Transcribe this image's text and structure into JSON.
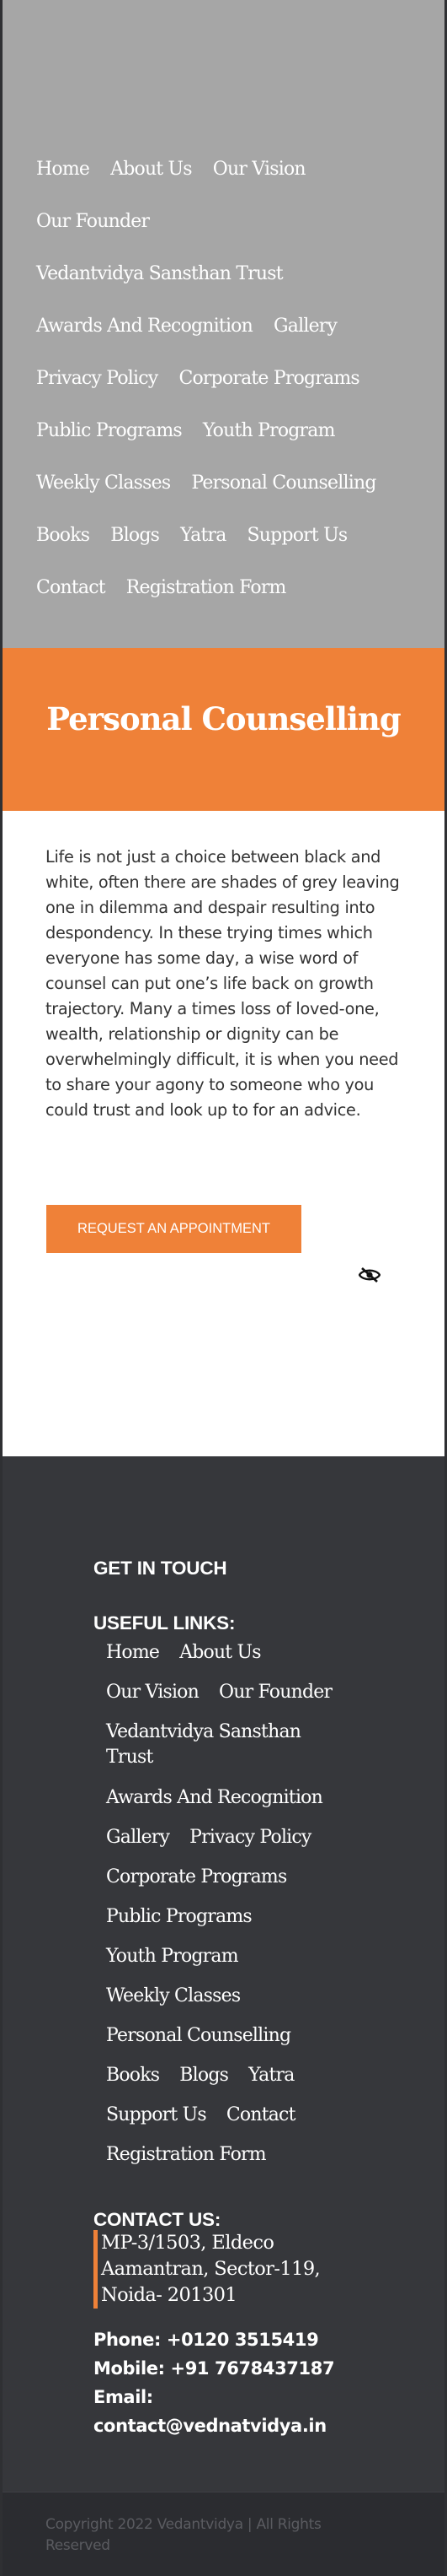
{
  "nav": {
    "rows": [
      [
        "Home",
        "About Us",
        "Our Vision"
      ],
      [
        "Our Founder"
      ],
      [
        "Vedantvidya Sansthan Trust"
      ],
      [
        "Awards And Recognition",
        "Gallery"
      ],
      [
        "Privacy Policy",
        "Corporate Programs"
      ],
      [
        "Public Programs",
        "Youth Program"
      ],
      [
        "Weekly Classes",
        "Personal Counselling"
      ],
      [
        "Books",
        "Blogs",
        "Yatra",
        "Support Us"
      ],
      [
        "Contact",
        "Registration Form"
      ]
    ]
  },
  "page": {
    "title": "Personal Counselling",
    "intro": "Life is not just a choice between black and white, often there are shades of grey leaving one in dilemma and despair resulting into despondency. In these trying times which everyone has some day, a wise word of counsel can put one’s life back on growth trajectory. Many a times loss of loved-one, wealth, relationship or dignity can be overwhelmingly difficult, it is when you need to share your agony to someone who you could trust and look up to for an advice.",
    "appointment_button": "Request An Appointment",
    "eye_icon": "eye-slash-icon"
  },
  "footer": {
    "get_in_touch": "GET IN TOUCH",
    "useful_links_heading": "USEFUL LINKS:",
    "useful_links": {
      "rows": [
        [
          "Home",
          "About Us"
        ],
        [
          "Our Vision",
          "Our Founder"
        ],
        [
          "Vedantvidya Sansthan Trust"
        ],
        [
          "Awards And Recognition"
        ],
        [
          "Gallery",
          "Privacy Policy"
        ],
        [
          "Corporate Programs"
        ],
        [
          "Public Programs"
        ],
        [
          "Youth Program"
        ],
        [
          "Weekly Classes"
        ],
        [
          "Personal Counselling"
        ],
        [
          "Books",
          "Blogs",
          "Yatra"
        ],
        [
          "Support Us",
          "Contact"
        ],
        [
          "Registration Form"
        ]
      ]
    },
    "contact_heading": "CONTACT US:",
    "address": "MP-3/1503, Eldeco Aamantran, Sector-119, Noida- 201301",
    "phone": "Phone: +0120 3515419",
    "mobile": "Mobile: +91 7678437187",
    "email_label": "Email:",
    "email": "contact@vednatvidya.in",
    "copyright": "Copyright 2022 Vedantvidya | All Rights Reserved"
  },
  "colors": {
    "accent": "#ef8138",
    "header_bg": "#a6a6a6",
    "footer_bg": "#36373b",
    "content_bg": "#ffffff"
  }
}
